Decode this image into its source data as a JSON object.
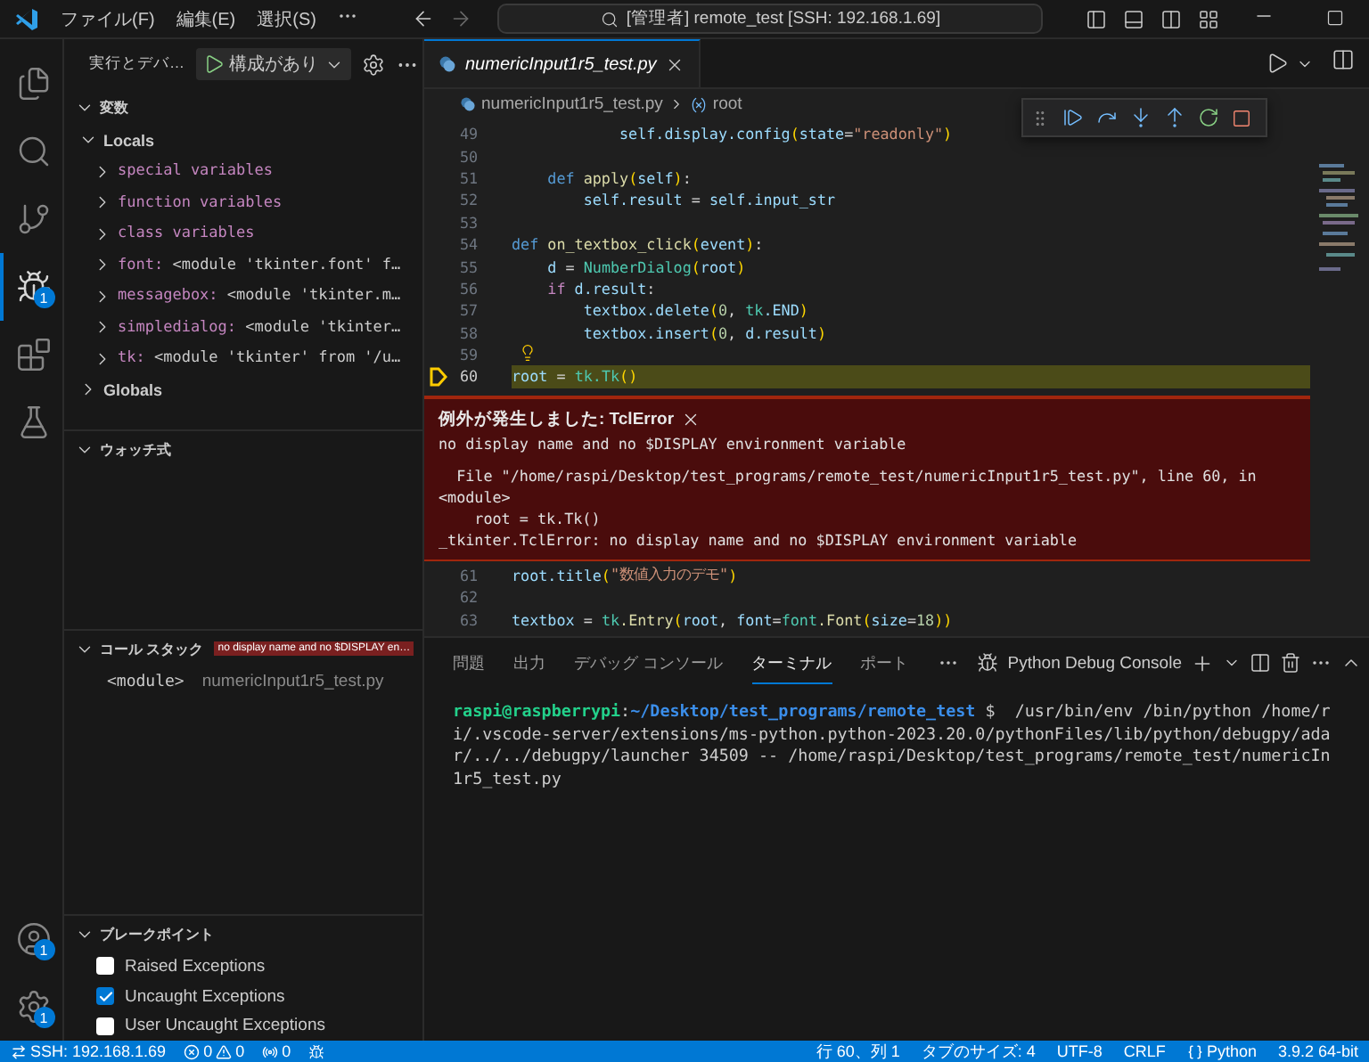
{
  "titlebar": {
    "menus": [
      "ファイル(F)",
      "編集(E)",
      "選択(S)"
    ],
    "search": "[管理者] remote_test [SSH: 192.168.1.69]"
  },
  "activity": [
    {
      "kind": "explorer",
      "selected": false
    },
    {
      "kind": "search",
      "selected": false
    },
    {
      "kind": "scm",
      "selected": false
    },
    {
      "kind": "run",
      "selected": true,
      "badge": "1"
    },
    {
      "kind": "extensions",
      "selected": false
    },
    {
      "kind": "testing",
      "selected": false
    }
  ],
  "activity_bottom": [
    {
      "kind": "accounts",
      "badge": "1"
    },
    {
      "kind": "manage",
      "badge": "1"
    }
  ],
  "sidebar": {
    "title": "実行とデバ…",
    "config": "構成があり",
    "variables": {
      "title": "変数",
      "expanded": true,
      "scopes": [
        {
          "name": "Locals",
          "expanded": true,
          "items": [
            {
              "name": "special variables",
              "expanded": false
            },
            {
              "name": "function variables",
              "expanded": false
            },
            {
              "name": "class variables",
              "expanded": false
            },
            {
              "name": "font:",
              "value": "<module 'tkinter.font' f…",
              "expanded": false
            },
            {
              "name": "messagebox:",
              "value": "<module 'tkinter.m…",
              "expanded": false
            },
            {
              "name": "simpledialog:",
              "value": "<module 'tkinter…",
              "expanded": false
            },
            {
              "name": "tk:",
              "value": "<module 'tkinter' from '/u…",
              "expanded": false
            }
          ]
        },
        {
          "name": "Globals",
          "expanded": false
        }
      ]
    },
    "watch": {
      "title": "ウォッチ式",
      "expanded": true
    },
    "callstack": {
      "title": "コール スタック",
      "expanded": true,
      "badge": "no display name and no $DISPLAY en…",
      "frames": [
        {
          "name": "<module>",
          "file": "numericInput1r5_test.py"
        }
      ]
    },
    "breakpoints": {
      "title": "ブレークポイント",
      "expanded": true,
      "items": [
        {
          "label": "Raised Exceptions",
          "checked": false
        },
        {
          "label": "Uncaught Exceptions",
          "checked": true
        },
        {
          "label": "User Uncaught Exceptions",
          "checked": false
        }
      ]
    }
  },
  "editor": {
    "tabs": [
      {
        "label": "numericInput1r5_test.py",
        "selected": true
      }
    ],
    "breadcrumbs": [
      "numericInput1r5_test.py",
      "root"
    ],
    "lines_before": [
      {
        "n": "49",
        "current": false,
        "lightbulb": false,
        "tokens": [
          {
            "t": "            self.display.config",
            "color": "#9cdcfe"
          },
          {
            "t": "(",
            "color": "#ffd700"
          },
          {
            "t": "state",
            "color": "#9cdcfe"
          },
          {
            "t": "=",
            "color": "#d4d4d4"
          },
          {
            "t": "\"readonly\"",
            "color": "#ce9178"
          },
          {
            "t": ")",
            "color": "#ffd700"
          }
        ]
      },
      {
        "n": "50",
        "current": false,
        "lightbulb": false
      },
      {
        "n": "51",
        "current": false,
        "lightbulb": false,
        "tokens": [
          {
            "t": "    def",
            "color": "#569cd6"
          },
          {
            "t": " apply",
            "color": "#dcdcaa"
          },
          {
            "t": "(",
            "color": "#ffd700"
          },
          {
            "t": "self",
            "color": "#9cdcfe"
          },
          {
            "t": ")",
            "color": "#ffd700"
          },
          {
            "t": ":",
            "color": "#d4d4d4"
          }
        ]
      },
      {
        "n": "52",
        "current": false,
        "lightbulb": false,
        "tokens": [
          {
            "t": "        self.result",
            "color": "#9cdcfe"
          },
          {
            "t": " = ",
            "color": "#d4d4d4"
          },
          {
            "t": "self.input_str",
            "color": "#9cdcfe"
          }
        ]
      },
      {
        "n": "53",
        "current": false,
        "lightbulb": false
      },
      {
        "n": "54",
        "current": false,
        "lightbulb": false,
        "tokens": [
          {
            "t": "def",
            "color": "#569cd6"
          },
          {
            "t": " on_textbox_click",
            "color": "#dcdcaa"
          },
          {
            "t": "(",
            "color": "#ffd700"
          },
          {
            "t": "event",
            "color": "#9cdcfe"
          },
          {
            "t": ")",
            "color": "#ffd700"
          },
          {
            "t": ":",
            "color": "#d4d4d4"
          }
        ]
      },
      {
        "n": "55",
        "current": false,
        "lightbulb": false,
        "tokens": [
          {
            "t": "    d",
            "color": "#9cdcfe"
          },
          {
            "t": " = ",
            "color": "#d4d4d4"
          },
          {
            "t": "NumberDialog",
            "color": "#4ec9b0"
          },
          {
            "t": "(",
            "color": "#ffd700"
          },
          {
            "t": "root",
            "color": "#9cdcfe"
          },
          {
            "t": ")",
            "color": "#ffd700"
          }
        ]
      },
      {
        "n": "56",
        "current": false,
        "lightbulb": false,
        "tokens": [
          {
            "t": "    if",
            "color": "#c586c0"
          },
          {
            "t": " d.result",
            "color": "#9cdcfe"
          },
          {
            "t": ":",
            "color": "#d4d4d4"
          }
        ]
      },
      {
        "n": "57",
        "current": false,
        "lightbulb": false,
        "tokens": [
          {
            "t": "        textbox.delete",
            "color": "#9cdcfe"
          },
          {
            "t": "(",
            "color": "#ffd700"
          },
          {
            "t": "0",
            "color": "#b5cea8"
          },
          {
            "t": ", ",
            "color": "#d4d4d4"
          },
          {
            "t": "tk",
            "color": "#4ec9b0"
          },
          {
            "t": ".END",
            "color": "#9cdcfe"
          },
          {
            "t": ")",
            "color": "#ffd700"
          }
        ]
      },
      {
        "n": "58",
        "current": false,
        "lightbulb": false,
        "tokens": [
          {
            "t": "        textbox.insert",
            "color": "#9cdcfe"
          },
          {
            "t": "(",
            "color": "#ffd700"
          },
          {
            "t": "0",
            "color": "#b5cea8"
          },
          {
            "t": ", ",
            "color": "#d4d4d4"
          },
          {
            "t": "d.result",
            "color": "#9cdcfe"
          },
          {
            "t": ")",
            "color": "#ffd700"
          }
        ]
      },
      {
        "n": "59",
        "current": false,
        "lightbulb": true
      },
      {
        "n": "60",
        "current": true,
        "lightbulb": false,
        "tokens": [
          {
            "t": "root",
            "color": "#9cdcfe"
          },
          {
            "t": " = ",
            "color": "#d4d4d4"
          },
          {
            "t": "tk.Tk",
            "color": "#4ec9b0"
          },
          {
            "t": "()",
            "color": "#ffd700"
          }
        ]
      }
    ],
    "exception": {
      "title": "例外が発生しました: TclError",
      "message": "no display name and no $DISPLAY environment variable",
      "trace": [
        "  File \"/home/raspi/Desktop/test_programs/remote_test/numericInput1r5_test.py\", line 60, in",
        "<module>",
        "    root = tk.Tk()",
        "_tkinter.TclError: no display name and no $DISPLAY environment variable"
      ]
    },
    "lines_after": [
      {
        "n": "61",
        "current": false,
        "lightbulb": false,
        "tokens": [
          {
            "t": "root.title",
            "color": "#9cdcfe"
          },
          {
            "t": "(",
            "color": "#ffd700"
          },
          {
            "t": "\"数値入力のデモ\"",
            "color": "#ce9178"
          },
          {
            "t": ")",
            "color": "#ffd700"
          }
        ]
      },
      {
        "n": "62",
        "current": false,
        "lightbulb": false
      },
      {
        "n": "63",
        "current": false,
        "lightbulb": false,
        "tokens": [
          {
            "t": "textbox",
            "color": "#9cdcfe"
          },
          {
            "t": " = ",
            "color": "#d4d4d4"
          },
          {
            "t": "tk",
            "color": "#4ec9b0"
          },
          {
            "t": ".Entry",
            "color": "#dcdcaa"
          },
          {
            "t": "(",
            "color": "#ffd700"
          },
          {
            "t": "root",
            "color": "#9cdcfe"
          },
          {
            "t": ", ",
            "color": "#d4d4d4"
          },
          {
            "t": "font",
            "color": "#9cdcfe"
          },
          {
            "t": "=",
            "color": "#d4d4d4"
          },
          {
            "t": "font",
            "color": "#4ec9b0"
          },
          {
            "t": ".Font",
            "color": "#dcdcaa"
          },
          {
            "t": "(",
            "color": "#ffd700"
          },
          {
            "t": "size",
            "color": "#9cdcfe"
          },
          {
            "t": "=",
            "color": "#d4d4d4"
          },
          {
            "t": "18",
            "color": "#b5cea8"
          },
          {
            "t": "))",
            "color": "#ffd700"
          }
        ]
      }
    ]
  },
  "panel": {
    "tabs": [
      {
        "label": "問題",
        "selected": false
      },
      {
        "label": "出力",
        "selected": false
      },
      {
        "label": "デバッグ コンソール",
        "selected": false
      },
      {
        "label": "ターミナル",
        "selected": true
      },
      {
        "label": "ポート",
        "selected": false
      }
    ],
    "terminal_name": "Python Debug Console",
    "terminal": {
      "user": "raspi@raspberrypi",
      "separator": ":",
      "path": "~/Desktop/test_programs/remote_test",
      "lines": [
        " $  /usr/bin/env /bin/python /home/r",
        "i/.vscode-server/extensions/ms-python.python-2023.20.0/pythonFiles/lib/python/debugpy/ada",
        "r/../../debugpy/launcher 34509 -- /home/raspi/Desktop/test_programs/remote_test/numericIn",
        "1r5_test.py"
      ]
    }
  },
  "status_bar": {
    "remote": "SSH: 192.168.1.69",
    "errors": "0",
    "warnings": "0",
    "ports": "0",
    "right": [
      {
        "kind": "text",
        "label": "行 60、列 1"
      },
      {
        "kind": "text",
        "label": "タブのサイズ: 4"
      },
      {
        "kind": "text",
        "label": "UTF-8"
      },
      {
        "kind": "text",
        "label": "CRLF"
      },
      {
        "kind": "language",
        "label": "Python"
      },
      {
        "kind": "text",
        "label": "3.9.2 64-bit"
      }
    ]
  }
}
